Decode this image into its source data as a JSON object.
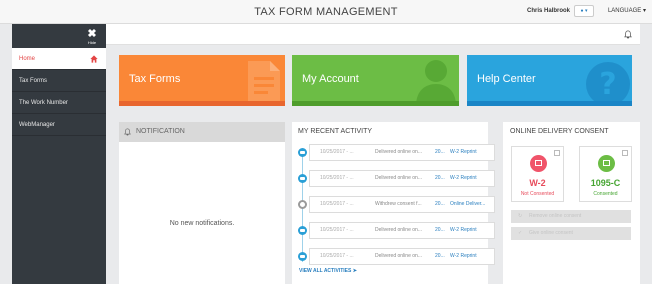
{
  "header": {
    "title": "TAX FORM MANAGEMENT",
    "user_name": "Chris Halbrook",
    "language_label": "LANGUAGE"
  },
  "sidebar": {
    "hide_label": "Hide",
    "items": [
      {
        "label": "Home",
        "active": true
      },
      {
        "label": "Tax Forms"
      },
      {
        "label": "The Work Number"
      },
      {
        "label": "WebManager"
      }
    ]
  },
  "tiles": {
    "tax_forms": "Tax Forms",
    "my_account": "My Account",
    "help_center": "Help Center"
  },
  "notification": {
    "title": "NOTIFICATION",
    "empty_text": "No new notifications."
  },
  "activity": {
    "title": "MY RECENT ACTIVITY",
    "rows": [
      {
        "date": "10/25/2017 - ...",
        "desc": "Delivered online on...",
        "year": "20...",
        "form": "W-2 Reprint",
        "icon": "mail"
      },
      {
        "date": "10/25/2017 - ...",
        "desc": "Delivered online on...",
        "year": "20...",
        "form": "W-2 Reprint",
        "icon": "mail"
      },
      {
        "date": "10/25/2017 - ...",
        "desc": "Withdrew consent f...",
        "year": "20...",
        "form": "Online Deliver...",
        "icon": "circle"
      },
      {
        "date": "10/25/2017 - ...",
        "desc": "Delivered online on...",
        "year": "20...",
        "form": "W-2 Reprint",
        "icon": "mail"
      },
      {
        "date": "10/25/2017 - ...",
        "desc": "Delivered online on...",
        "year": "20...",
        "form": "W-2 Reprint",
        "icon": "mail"
      }
    ],
    "view_all": "VIEW ALL ACTIVITIES"
  },
  "consent": {
    "title": "ONLINE DELIVERY CONSENT",
    "cards": [
      {
        "form": "W-2",
        "status": "Not Consented"
      },
      {
        "form": "1095-C",
        "status": "Consented"
      }
    ],
    "btn_remove": "Remove online consent",
    "btn_give": "Give online consent"
  },
  "colors": {
    "tax_forms": "#fa8737",
    "my_account": "#6cbd45",
    "help_center": "#2aa4dd",
    "sidebar": "#343a40",
    "not_consented": "#e74c5c",
    "consented": "#46a532"
  }
}
